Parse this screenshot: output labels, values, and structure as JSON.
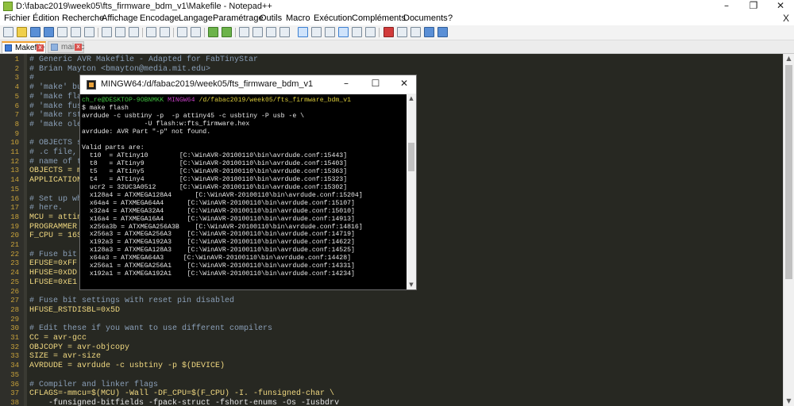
{
  "window": {
    "title": "D:\\fabac2019\\week05\\fts_firmware_bdm_v1\\Makefile - Notepad++",
    "minimize": "–",
    "maximize": "❐",
    "close": "✕"
  },
  "menu": {
    "items": [
      "Fichier",
      "Édition",
      "Recherche",
      "Affichage",
      "Encodage",
      "Langage",
      "Paramétrage",
      "Outils",
      "Macro",
      "Exécution",
      "Compléments",
      "Documents",
      "?"
    ],
    "close_glyph": "X"
  },
  "tabs": [
    {
      "label": "Makefile",
      "active": true,
      "close": "x"
    },
    {
      "label": "main.c",
      "active": false,
      "close": "x"
    }
  ],
  "colors": {
    "editor_bg": "#272822",
    "comment": "#8a9fb8",
    "variable": "#f0d880",
    "line_number": "#c8a23a",
    "terminal_bg": "#000000"
  },
  "editor": {
    "line_numbers": [
      "1",
      "2",
      "3",
      "4",
      "5",
      "6",
      "7",
      "8",
      "9",
      "10",
      "11",
      "12",
      "13",
      "14",
      "15",
      "16",
      "17",
      "18",
      "19",
      "20",
      "21",
      "22",
      "23",
      "24",
      "25",
      "26",
      "27",
      "28",
      "29",
      "30",
      "31",
      "32",
      "33",
      "34",
      "35",
      "36",
      "37",
      "38"
    ],
    "lines": [
      {
        "type": "comment",
        "text": "# Generic AVR Makefile - Adapted for FabTinyStar"
      },
      {
        "type": "comment",
        "text": "# Brian Mayton <bmayton@media.mit.edu>"
      },
      {
        "type": "comment",
        "text": "#"
      },
      {
        "type": "comment",
        "text": "# 'make' bu"
      },
      {
        "type": "comment",
        "text": "# 'make fla"
      },
      {
        "type": "comment",
        "text": "# 'make fus"
      },
      {
        "type": "comment",
        "text": "# 'make rst"
      },
      {
        "type": "comment",
        "text": "# 'make ole"
      },
      {
        "type": "blank",
        "text": ""
      },
      {
        "type": "comment",
        "text": "# OBJECTS s"
      },
      {
        "type": "comment",
        "text": "# .c file,"
      },
      {
        "type": "comment",
        "text": "# name of t"
      },
      {
        "type": "assign",
        "text": "OBJECTS = m"
      },
      {
        "type": "assign",
        "text": "APPLICATION"
      },
      {
        "type": "blank",
        "text": ""
      },
      {
        "type": "comment",
        "text": "# Set up wh"
      },
      {
        "type": "comment",
        "text": "# here."
      },
      {
        "type": "assign",
        "text": "MCU = attin"
      },
      {
        "type": "assign",
        "text": "PROGRAMMER"
      },
      {
        "type": "assign",
        "text": "F_CPU = 16S"
      },
      {
        "type": "blank",
        "text": ""
      },
      {
        "type": "comment",
        "text": "# Fuse bit"
      },
      {
        "type": "assign",
        "text": "EFUSE=0xFF"
      },
      {
        "type": "assign",
        "text": "HFUSE=0xDD"
      },
      {
        "type": "assign",
        "text": "LFUSE=0xE1"
      },
      {
        "type": "blank",
        "text": ""
      },
      {
        "type": "comment",
        "text": "# Fuse bit settings with reset pin disabled"
      },
      {
        "type": "assign",
        "text": "HFUSE_RSTDISBL=0x5D"
      },
      {
        "type": "blank",
        "text": ""
      },
      {
        "type": "comment",
        "text": "# Edit these if you want to use different compilers"
      },
      {
        "type": "assign",
        "text": "CC = avr-gcc"
      },
      {
        "type": "assign",
        "text": "OBJCOPY = avr-objcopy"
      },
      {
        "type": "assign",
        "text": "SIZE = avr-size"
      },
      {
        "type": "assign",
        "text": "AVRDUDE = avrdude -c usbtiny -p $(DEVICE)"
      },
      {
        "type": "blank",
        "text": ""
      },
      {
        "type": "comment",
        "text": "# Compiler and linker flags"
      },
      {
        "type": "assign",
        "text": "CFLAGS=-mmcu=$(MCU) -Wall -DF_CPU=$(F_CPU) -I. -funsigned-char \\"
      },
      {
        "type": "text",
        "text": "    -funsigned-bitfields -fpack-struct -fshort-enums -Os -Iusbdrv"
      }
    ]
  },
  "terminal": {
    "title": "MINGW64:/d/fabac2019/week05/fts_firmware_bdm_v1",
    "prompt_user": "ch_re@DESKTOP-9OBNMKK",
    "prompt_host": "MINGW64",
    "prompt_path": "/d/fabac2019/week05/fts_firmware_bdm_v1",
    "lines": [
      "$ make flash",
      "avrdude -c usbtiny -p  -p attiny45 -c usbtiny -P usb -e \\",
      "                -U flash:w:fts_firmware.hex",
      "avrdude: AVR Part \"-p\" not found.",
      "",
      "Valid parts are:",
      "  t10  = ATtiny10        [C:\\WinAVR-20100110\\bin\\avrdude.conf:15443]",
      "  t8   = ATtiny9         [C:\\WinAVR-20100110\\bin\\avrdude.conf:15403]",
      "  t5   = ATtiny5         [C:\\WinAVR-20100110\\bin\\avrdude.conf:15363]",
      "  t4   = ATtiny4         [C:\\WinAVR-20100110\\bin\\avrdude.conf:15323]",
      "  ucr2 = 32UC3A0512      [C:\\WinAVR-20100110\\bin\\avrdude.conf:15302]",
      "  x128a4 = ATXMEGA128A4      [C:\\WinAVR-20100110\\bin\\avrdude.conf:15204]",
      "  x64a4 = ATXMEGA64A4      [C:\\WinAVR-20100110\\bin\\avrdude.conf:15107]",
      "  x32a4 = ATXMEGA32A4      [C:\\WinAVR-20100110\\bin\\avrdude.conf:15010]",
      "  x16a4 = ATXMEGA16A4      [C:\\WinAVR-20100110\\bin\\avrdude.conf:14913]",
      "  x256a3b = ATXMEGA256A3B    [C:\\WinAVR-20100110\\bin\\avrdude.conf:14816]",
      "  x256a3 = ATXMEGA256A3    [C:\\WinAVR-20100110\\bin\\avrdude.conf:14719]",
      "  x192a3 = ATXMEGA192A3    [C:\\WinAVR-20100110\\bin\\avrdude.conf:14622]",
      "  x128a3 = ATXMEGA128A3    [C:\\WinAVR-20100110\\bin\\avrdude.conf:14525]",
      "  x64a3 = ATXMEGA64A3     [C:\\WinAVR-20100110\\bin\\avrdude.conf:14428]",
      "  x256a1 = ATXMEGA256A1    [C:\\WinAVR-20100110\\bin\\avrdude.conf:14331]",
      "  x192a1 = ATXMEGA192A1    [C:\\WinAVR-20100110\\bin\\avrdude.conf:14234]"
    ]
  }
}
